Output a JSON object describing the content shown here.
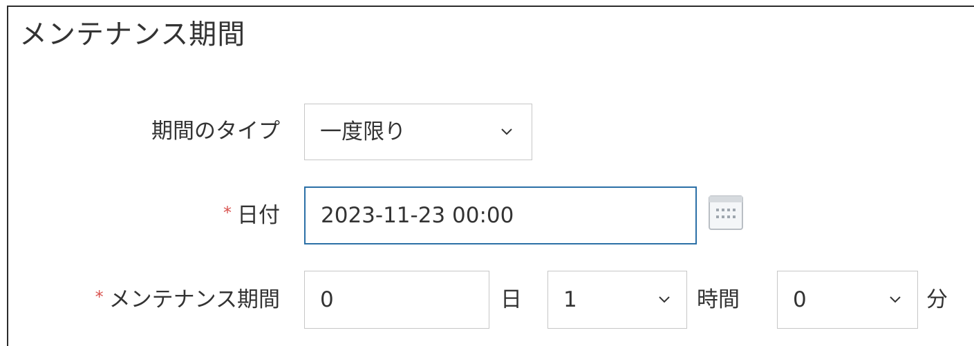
{
  "section": {
    "title": "メンテナンス期間"
  },
  "fields": {
    "period_type": {
      "label": "期間のタイプ",
      "value": "一度限り",
      "icon": "chevron-down-icon"
    },
    "date": {
      "required_mark": "*",
      "label": "日付",
      "value": "2023-11-23 00:00",
      "icon": "calendar-icon"
    },
    "duration": {
      "required_mark": "*",
      "label": "メンテナンス期間",
      "days_value": "0",
      "days_unit": "日",
      "hours_value": "1",
      "hours_unit": "時間",
      "minutes_value": "0",
      "minutes_unit": "分"
    }
  },
  "colors": {
    "required": "#d9534f",
    "focus_border": "#2a6fa6",
    "border": "#c6c6c6",
    "text": "#333333"
  }
}
